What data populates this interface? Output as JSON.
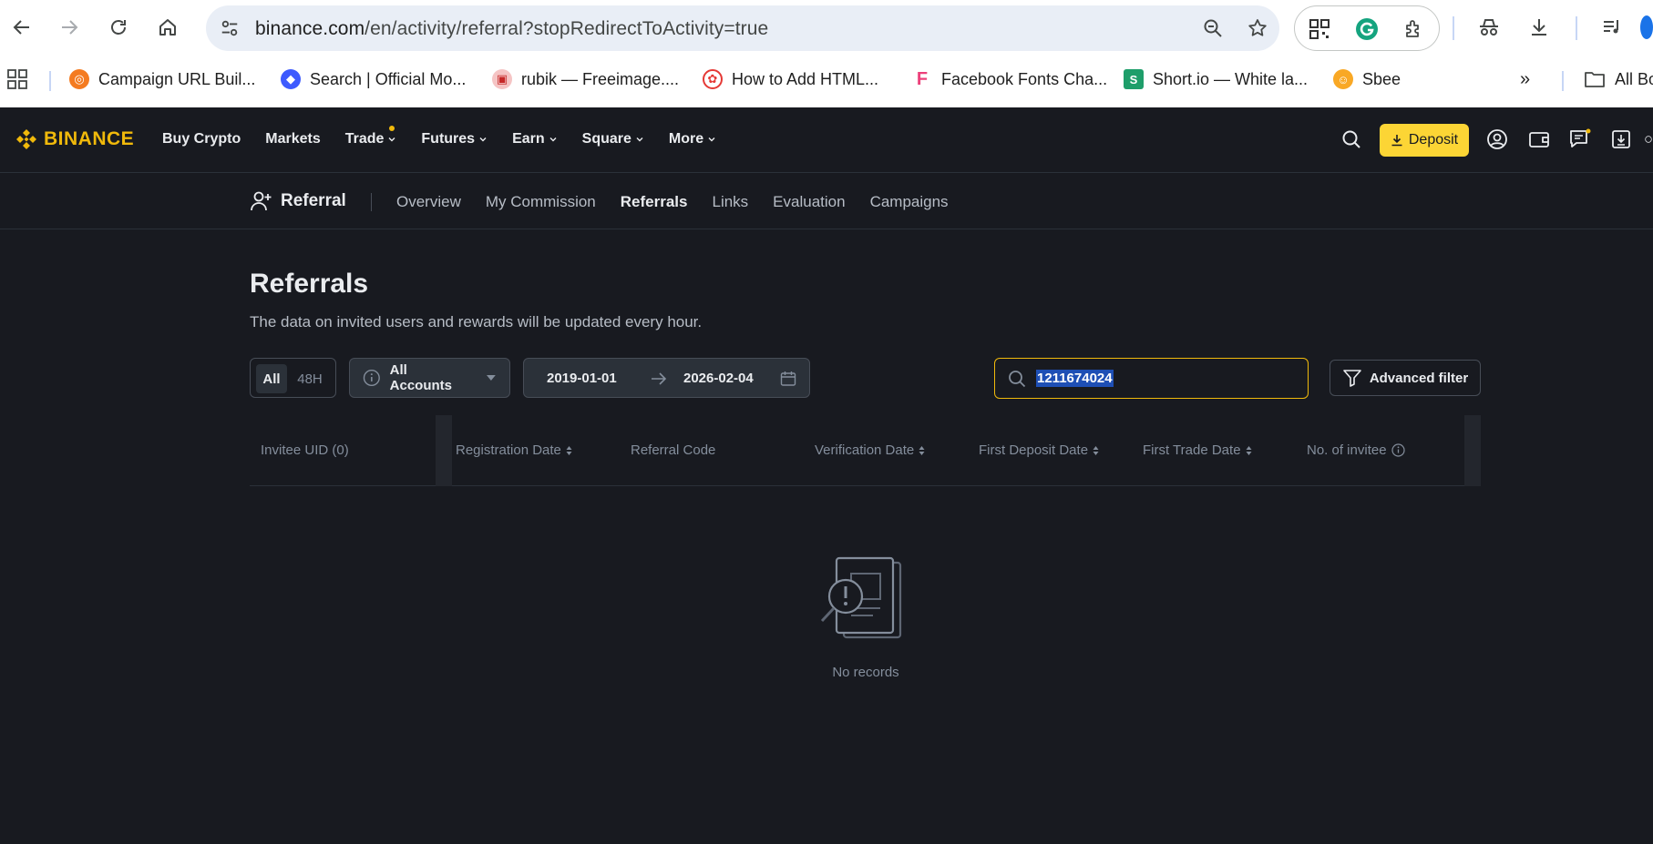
{
  "browser": {
    "url_host": "binance.com",
    "url_path": "/en/activity/referral?stopRedirectToActivity=true",
    "bookmarks": [
      {
        "label": "Campaign URL Buil...",
        "icon": "campaign-url-icon",
        "color": "#F47B20"
      },
      {
        "label": "Search | Official Mo...",
        "icon": "search-official-icon",
        "color": "#3D5AFE"
      },
      {
        "label": "rubik — Freeimage....",
        "icon": "freeimage-icon",
        "color": "#E57373"
      },
      {
        "label": "How to Add HTML...",
        "icon": "html-icon",
        "color": "#E53935"
      },
      {
        "label": "Facebook Fonts Cha...",
        "icon": "facebook-fonts-icon",
        "color": "#EC407A"
      },
      {
        "label": "Short.io — White la...",
        "icon": "shortio-icon",
        "color": "#1E9E6A"
      },
      {
        "label": "Sbee",
        "icon": "sbee-icon",
        "color": "#F9A825"
      }
    ],
    "all_bookmarks_label": "All Bo"
  },
  "header": {
    "logo_text": "BINANCE",
    "nav": [
      {
        "label": "Buy Crypto",
        "has_menu": false
      },
      {
        "label": "Markets",
        "has_menu": false
      },
      {
        "label": "Trade",
        "has_menu": true
      },
      {
        "label": "Futures",
        "has_menu": true
      },
      {
        "label": "Earn",
        "has_menu": true
      },
      {
        "label": "Square",
        "has_menu": true
      },
      {
        "label": "More",
        "has_menu": true
      }
    ],
    "deposit_label": "Deposit",
    "accent_color": "#F0B90B"
  },
  "subnav": {
    "brand": "Referral",
    "tabs": [
      "Overview",
      "My Commission",
      "Referrals",
      "Links",
      "Evaluation",
      "Campaigns"
    ],
    "active_tab": "Referrals"
  },
  "main": {
    "title": "Referrals",
    "subtitle": "The data on invited users and rewards will be updated every hour.",
    "range_toggle": {
      "options": [
        "All",
        "48H"
      ],
      "selected": "All"
    },
    "account_select": "All Accounts",
    "date_from": "2019-01-01",
    "date_to": "2026-02-04",
    "search_value": "1211674024",
    "advanced_filter_label": "Advanced filter",
    "table": {
      "columns": [
        "Invitee UID (0)",
        "Registration Date",
        "Referral Code",
        "Verification Date",
        "First Deposit Date",
        "First Trade Date",
        "No. of invitee"
      ],
      "rows": []
    },
    "empty_text": "No records"
  }
}
